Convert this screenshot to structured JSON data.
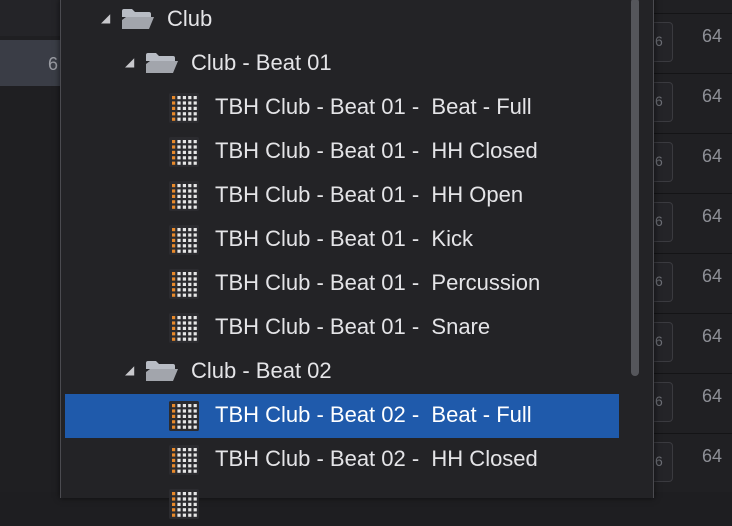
{
  "background": {
    "left_value": "6",
    "right_rows": [
      {
        "digit": "6",
        "value": "64"
      },
      {
        "digit": "6",
        "value": "64"
      },
      {
        "digit": "6",
        "value": "64"
      },
      {
        "digit": "6",
        "value": "64"
      },
      {
        "digit": "6",
        "value": "64"
      },
      {
        "digit": "6",
        "value": "64"
      },
      {
        "digit": "6",
        "value": "64"
      },
      {
        "digit": "6",
        "value": "64"
      }
    ]
  },
  "browser": {
    "items": [
      {
        "type": "folder",
        "label": "Club",
        "level": 0,
        "expanded": true,
        "selected": false
      },
      {
        "type": "folder",
        "label": "Club - Beat 01",
        "level": 1,
        "expanded": true,
        "selected": false
      },
      {
        "type": "pattern",
        "label": "TBH Club - Beat 01 -  Beat - Full",
        "level": 2,
        "selected": false
      },
      {
        "type": "pattern",
        "label": "TBH Club - Beat 01 -  HH Closed",
        "level": 2,
        "selected": false
      },
      {
        "type": "pattern",
        "label": "TBH Club - Beat 01 -  HH Open",
        "level": 2,
        "selected": false
      },
      {
        "type": "pattern",
        "label": "TBH Club - Beat 01 -  Kick",
        "level": 2,
        "selected": false
      },
      {
        "type": "pattern",
        "label": "TBH Club - Beat 01 -  Percussion",
        "level": 2,
        "selected": false
      },
      {
        "type": "pattern",
        "label": "TBH Club - Beat 01 -  Snare",
        "level": 2,
        "selected": false
      },
      {
        "type": "folder",
        "label": "Club - Beat 02",
        "level": 1,
        "expanded": true,
        "selected": false
      },
      {
        "type": "pattern",
        "label": "TBH Club - Beat 02 -  Beat - Full",
        "level": 2,
        "selected": true
      },
      {
        "type": "pattern",
        "label": "TBH Club - Beat 02 -  HH Closed",
        "level": 2,
        "selected": false
      },
      {
        "type": "pattern",
        "label": "",
        "level": 2,
        "selected": false
      }
    ]
  },
  "colors": {
    "selection": "#1f5aab",
    "pattern_orange": "#e8892a",
    "pattern_white": "#e6e6e6",
    "folder": "#b8bcc4"
  }
}
